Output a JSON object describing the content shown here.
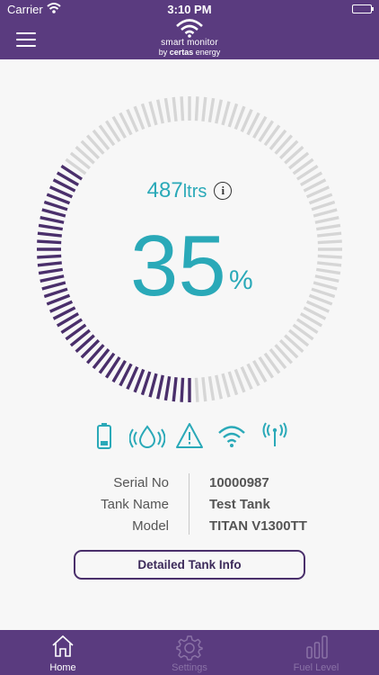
{
  "status_bar": {
    "carrier": "Carrier",
    "time": "3:10 PM"
  },
  "header": {
    "brand_line1": "smart monitor",
    "brand_prefix": "by ",
    "brand_bold": "certas",
    "brand_suffix": " energy"
  },
  "gauge": {
    "litres_value": "487",
    "litres_unit": "ltrs",
    "percent": "35",
    "percent_symbol": "%",
    "fill_fraction": 0.35,
    "filled_color": "#4a2f6b",
    "empty_color": "#d6d6d6",
    "value_color": "#2aa9b8"
  },
  "status_icons": [
    "battery-icon",
    "water-sensor-icon",
    "warning-icon",
    "wifi-icon",
    "antenna-icon"
  ],
  "details": {
    "rows": [
      {
        "label": "Serial No",
        "value": "10000987"
      },
      {
        "label": "Tank Name",
        "value": "Test Tank"
      },
      {
        "label": "Model",
        "value": "TITAN V1300TT"
      }
    ]
  },
  "detail_button_label": "Detailed Tank Info",
  "tabs": [
    {
      "label": "Home",
      "active": true
    },
    {
      "label": "Settings",
      "active": false
    },
    {
      "label": "Fuel Level",
      "active": false
    }
  ],
  "colors": {
    "brand_purple": "#5a3b7f",
    "teal": "#2aa9b8",
    "icon_teal": "#2aa9b8"
  }
}
